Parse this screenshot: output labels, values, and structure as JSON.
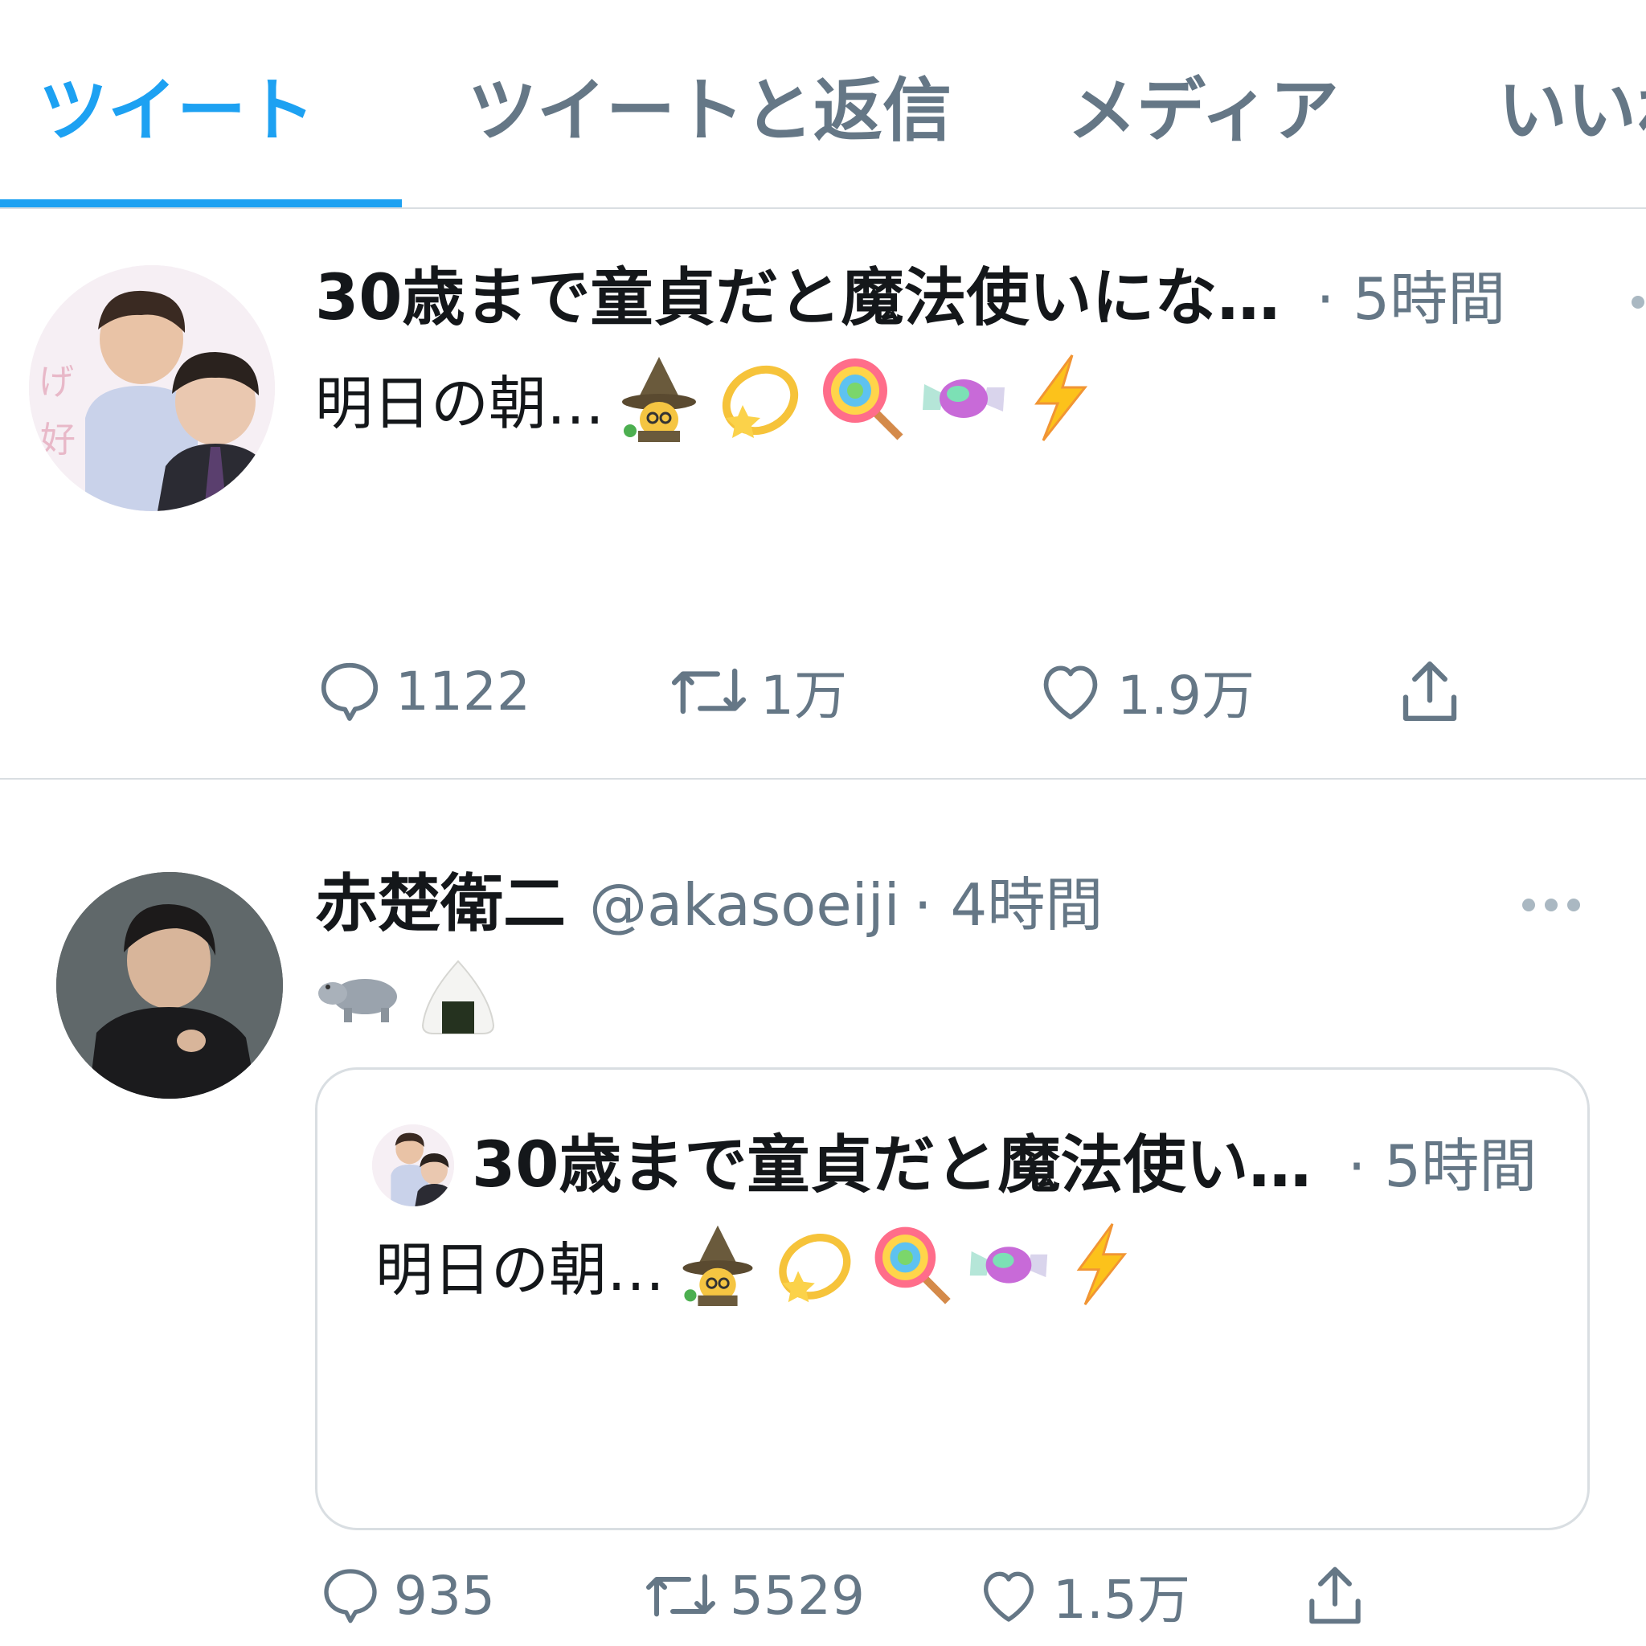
{
  "tabs": [
    {
      "label": "ツイート",
      "active": true
    },
    {
      "label": "ツイートと返信",
      "active": false
    },
    {
      "label": "メディア",
      "active": false
    },
    {
      "label": "いいね",
      "active": false
    }
  ],
  "tweet1": {
    "display_name": "30歳まで童貞だと魔法使いにな…",
    "time": "· 5時間",
    "text": "明日の朝…",
    "emojis": [
      "wizard-emoji",
      "dizzy-star-emoji",
      "lollipop-emoji",
      "candy-emoji",
      "lightning-emoji"
    ],
    "actions": {
      "replies": "1122",
      "retweets": "1万",
      "likes": "1.9万"
    }
  },
  "tweet2": {
    "display_name": "赤楚衛二",
    "handle": "@akasoeiji",
    "time": "· 4時間",
    "emojis": [
      "hippo-emoji",
      "rice-ball-emoji"
    ],
    "quote": {
      "display_name": "30歳まで童貞だと魔法使い…",
      "time": "· 5時間",
      "text": "明日の朝…"
    },
    "actions": {
      "replies": "935",
      "retweets": "5529",
      "likes": "1.5万"
    }
  },
  "colors": {
    "accent": "#1da1f2",
    "secondary_text": "#657786",
    "divider": "#d9dee2"
  }
}
